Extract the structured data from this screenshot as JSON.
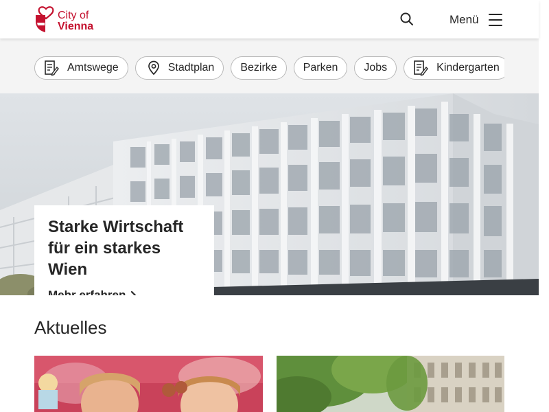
{
  "header": {
    "logo_line1": "City of",
    "logo_line2": "Vienna",
    "menu_label": "Menü"
  },
  "quick_links": [
    {
      "label": "Amtswege",
      "icon": "document-edit-icon"
    },
    {
      "label": "Stadtplan",
      "icon": "map-pin-icon"
    },
    {
      "label": "Bezirke"
    },
    {
      "label": "Parken"
    },
    {
      "label": "Jobs"
    },
    {
      "label": "Kindergarten",
      "icon": "document-edit-icon"
    }
  ],
  "hero": {
    "title": "Starke Wirtschaft für ein starkes Wien",
    "link_label": "Mehr erfahren"
  },
  "news": {
    "section_title": "Aktuelles"
  },
  "colors": {
    "brand_red": "#c4122f",
    "text": "#262626",
    "band_bg": "#f4f4f4"
  }
}
